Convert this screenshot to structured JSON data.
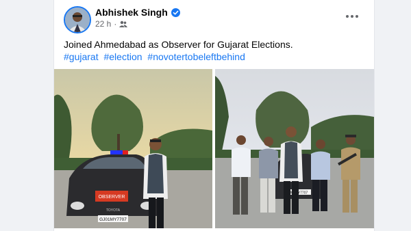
{
  "post": {
    "author": "Abhishek Singh",
    "time": "22 h",
    "audience_icon": "friends-icon",
    "text": "Joined Ahmedabad as Observer for Gujarat Elections.",
    "hashtags": [
      "#gujarat",
      "#election",
      "#novotertobeleftbehind"
    ]
  },
  "photos": {
    "photo1": {
      "plate_sign": "OBSERVER",
      "plate_number": "GJ01MY7707",
      "car_brand": "TOYOTA"
    },
    "photo2": {
      "plate_number": "GJ01MY7707"
    }
  },
  "colors": {
    "link": "#1877f2",
    "verified": "#1877f2",
    "text": "#050505",
    "meta": "#65676b"
  }
}
